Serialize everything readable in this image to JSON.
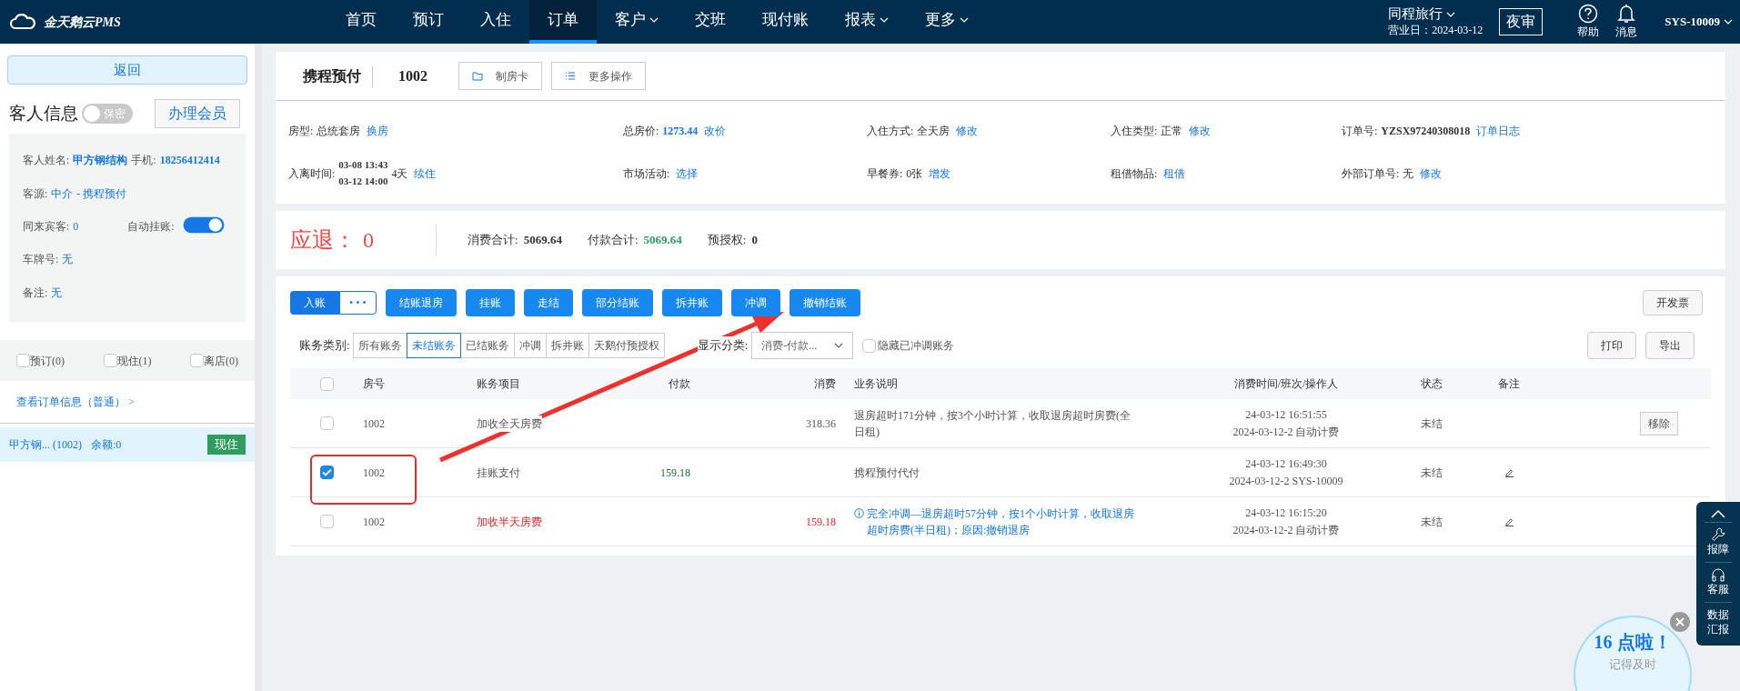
{
  "top_nav": {
    "logo": "金天鹅云PMS",
    "items": [
      {
        "label": "首页",
        "selected": false,
        "has_menu": false
      },
      {
        "label": "预订",
        "selected": false,
        "has_menu": false
      },
      {
        "label": "入住",
        "selected": false,
        "has_menu": false
      },
      {
        "label": "订单",
        "selected": true,
        "has_menu": false
      },
      {
        "label": "客户",
        "selected": false,
        "has_menu": true
      },
      {
        "label": "交班",
        "selected": false,
        "has_menu": false
      },
      {
        "label": "现付账",
        "selected": false,
        "has_menu": false
      },
      {
        "label": "报表",
        "selected": false,
        "has_menu": true
      },
      {
        "label": "更多",
        "selected": false,
        "has_menu": true
      }
    ],
    "hotel": "同程旅行",
    "business_day": "营业日：2024-03-12",
    "night_audit": "夜审",
    "help": "帮助",
    "messages": "消息",
    "user": "SYS-10009"
  },
  "sidebar": {
    "back": "返回",
    "guest_title": "客人信息",
    "privacy_toggle": {
      "label": "保密",
      "on": false
    },
    "member_button": "办理会员",
    "name_label": "客人姓名:",
    "name": "甲方钢结构",
    "phone_label": "手机:",
    "phone": "18256412414",
    "source_label": "客源:",
    "source": "中介",
    "channel": "- 携程预付",
    "companions_label": "同来宾客:",
    "companions": "0",
    "auto_charge_label": "自动挂账:",
    "auto_charge": {
      "on": true
    },
    "plate_label": "车牌号:",
    "plate": "无",
    "note_label": "备注:",
    "note": "无",
    "filters": [
      {
        "label": "预订(0)",
        "checked": false
      },
      {
        "label": "现住(1)",
        "checked": false
      },
      {
        "label": "离店(0)",
        "checked": false
      }
    ],
    "order_link": "查看订单信息（普通） >",
    "rooms": [
      {
        "name": "甲方钢... (1002)",
        "balance": "余额:0",
        "status": "现住",
        "selected": true
      }
    ]
  },
  "header": {
    "title": "携程预付",
    "room": "1002",
    "actions": [
      {
        "label": "制房卡",
        "kind": "card"
      },
      {
        "label": "更多操作",
        "kind": "list"
      }
    ]
  },
  "details": [
    {
      "label": "房型:",
      "value": "总统套房",
      "kind": "plain",
      "link": "换房"
    },
    {
      "label": "总房价:",
      "value": "1273.44",
      "kind": "price",
      "link": "改价"
    },
    {
      "label": "入住方式:",
      "value": "全天房",
      "kind": "plain",
      "link": "修改"
    },
    {
      "label": "入住类型:",
      "value": "正常",
      "kind": "plain",
      "link": "修改"
    },
    {
      "label": "订单号:",
      "value": "YZSX97240308018",
      "kind": "code",
      "link": "订单日志"
    },
    {
      "label": "入离时间:",
      "lines": [
        "03-08 13:43",
        "03-12 14:00"
      ],
      "value": "4天",
      "kind": "plain",
      "link": "续住"
    },
    {
      "label": "市场活动:",
      "link": "选择"
    },
    {
      "label": "早餐券:",
      "value": "0张",
      "kind": "plain",
      "link": "增发"
    },
    {
      "label": "租借物品:",
      "link": "租借"
    },
    {
      "label": "外部订单号:",
      "value": "无",
      "kind": "plain",
      "link": "修改"
    }
  ],
  "summary": {
    "refund_label": "应退：",
    "refund": "0",
    "spend_label": "消费合计:",
    "spend": "5069.64",
    "paid_label": "付款合计:",
    "paid": "5069.64",
    "preauth_label": "预授权:",
    "preauth": "0"
  },
  "toolbar": {
    "post": "入账",
    "more": "• • •",
    "buttons": [
      "结账退房",
      "挂账",
      "走结",
      "部分结账",
      "拆并账",
      "冲调",
      "撤销结账"
    ],
    "invoice": "开发票"
  },
  "filter": {
    "label": "账务类别:",
    "segments": [
      {
        "label": "所有账务",
        "selected": false
      },
      {
        "label": "未结账务",
        "selected": true
      },
      {
        "label": "已结账务",
        "selected": false
      },
      {
        "label": "冲调",
        "selected": false
      },
      {
        "label": "拆并账",
        "selected": false
      },
      {
        "label": "天鹅付预授权",
        "selected": false
      }
    ],
    "display_label": "显示分类:",
    "display_value": "消费-付款...",
    "hide_reversed": {
      "label": "隐藏已冲调账务",
      "checked": false
    },
    "print": "打印",
    "export": "导出"
  },
  "table": {
    "all_checked": false,
    "columns": [
      "房号",
      "账务项目",
      "付款",
      "消费",
      "业务说明",
      "消费时间/班次/操作人",
      "状态",
      "备注"
    ],
    "rows": [
      {
        "checked": false,
        "kind": "normal",
        "room": "1002",
        "item": "加收全天房费",
        "payment": "",
        "spend": "318.36",
        "desc": "退房超时171分钟，按3个小时计算，收取退房超时房费(全日租)",
        "time": "24-03-12 16:51:55",
        "operator": "2024-03-12-2 自动计费",
        "status": "未结",
        "editable": false,
        "action": "移除"
      },
      {
        "checked": true,
        "kind": "normal",
        "room": "1002",
        "item": "挂账支付",
        "payment": "159.18",
        "spend": "",
        "desc": "携程预付代付",
        "time": "24-03-12 16:49:30",
        "operator": "2024-03-12-2 SYS-10009",
        "status": "未结",
        "editable": true
      },
      {
        "checked": false,
        "kind": "reversal",
        "room": "1002",
        "item": "加收半天房费",
        "payment": "",
        "spend": "159.18",
        "desc": "完全冲调—退房超时57分钟，按1个小时计算，收取退房超时房费(半日租)；原因:撤销退房",
        "time": "24-03-12 16:15:20",
        "operator": "2024-03-12-2 自动计费",
        "status": "未结",
        "editable": true
      }
    ]
  },
  "float_bar": {
    "items": [
      {
        "label": "报障",
        "kind": "wrench"
      },
      {
        "label": "客服",
        "kind": "headset"
      },
      {
        "label": "数据汇报",
        "kind": "text"
      }
    ]
  },
  "reminder": {
    "title": "16 点啦！",
    "text": "记得及时"
  }
}
